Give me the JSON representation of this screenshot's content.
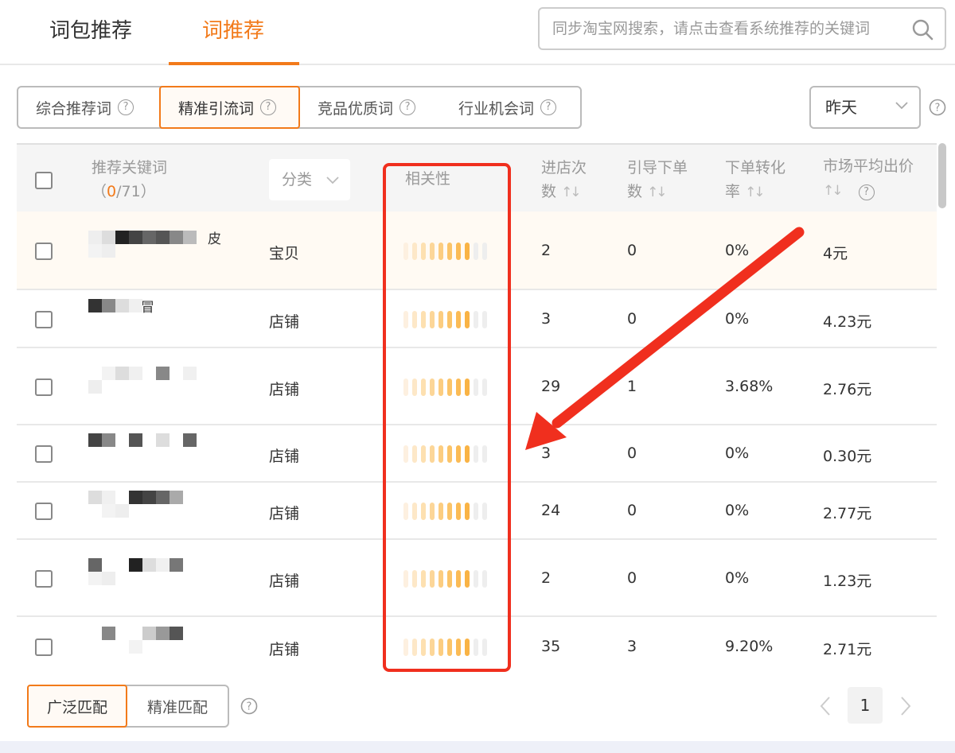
{
  "tabs": [
    {
      "label": "词包推荐"
    },
    {
      "label": "词推荐"
    }
  ],
  "search": {
    "placeholder": "同步淘宝网搜索，请点击查看系统推荐的关键词"
  },
  "filters": [
    {
      "label": "综合推荐词"
    },
    {
      "label": "精准引流词"
    },
    {
      "label": "竞品优质词"
    },
    {
      "label": "行业机会词"
    }
  ],
  "date_select": {
    "value": "昨天"
  },
  "table": {
    "columns": {
      "keyword": "推荐关键词",
      "keyword_count_open": "（",
      "keyword_count_selected": "0",
      "keyword_count_total": "/71）",
      "category": "分类",
      "relevance": "相关性",
      "visits_line1": "进店次",
      "visits_line2": "数",
      "orders_line1": "引导下单",
      "orders_line2": "数",
      "conversion_line1": "下单转化",
      "conversion_line2": "率",
      "bid": "市场平均出价"
    },
    "rows": [
      {
        "keyword_visible": "皮",
        "category": "宝贝",
        "relevance": 0.85,
        "visits": "2",
        "orders": "0",
        "conversion": "0%",
        "bid": "4元"
      },
      {
        "keyword_visible": "冒",
        "category": "店铺",
        "relevance": 0.85,
        "visits": "3",
        "orders": "0",
        "conversion": "0%",
        "bid": "4.23元"
      },
      {
        "keyword_visible": "",
        "category": "店铺",
        "relevance": 0.85,
        "visits": "29",
        "orders": "1",
        "conversion": "3.68%",
        "bid": "2.76元"
      },
      {
        "keyword_visible": "",
        "category": "店铺",
        "relevance": 0.85,
        "visits": "3",
        "orders": "0",
        "conversion": "0%",
        "bid": "0.30元"
      },
      {
        "keyword_visible": "",
        "category": "店铺",
        "relevance": 0.85,
        "visits": "24",
        "orders": "0",
        "conversion": "0%",
        "bid": "2.77元"
      },
      {
        "keyword_visible": "",
        "category": "店铺",
        "relevance": 0.85,
        "visits": "2",
        "orders": "0",
        "conversion": "0%",
        "bid": "1.23元"
      },
      {
        "keyword_visible": "",
        "category": "店铺",
        "relevance": 0.85,
        "visits": "35",
        "orders": "3",
        "conversion": "9.20%",
        "bid": "2.71元"
      }
    ]
  },
  "match": [
    {
      "label": "广泛匹配"
    },
    {
      "label": "精准匹配"
    }
  ],
  "pagination": {
    "current": "1"
  },
  "colors": {
    "accent": "#f27a1a",
    "annotation": "#f02f1e",
    "bar_levels": [
      "#fdf0e0",
      "#fde8c8",
      "#fde0b0",
      "#fcd698",
      "#fccd80",
      "#fbc468",
      "#fbbb55",
      "#f9b345",
      "#eeeeee",
      "#eeeeee"
    ]
  },
  "icons": {
    "search": "search-icon",
    "help": "question-circle-icon",
    "chevron": "chevron-down-icon"
  }
}
